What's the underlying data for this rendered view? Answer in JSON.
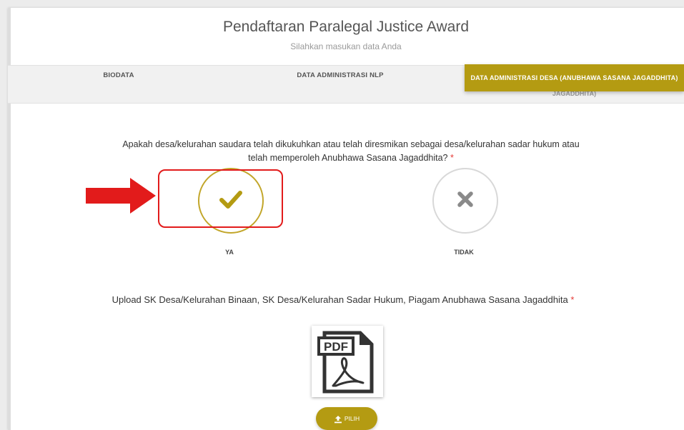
{
  "header": {
    "title": "Pendaftaran Paralegal Justice Award",
    "subtitle": "Silahkan masukan data Anda"
  },
  "tabs": [
    {
      "label": "BIODATA",
      "active": false
    },
    {
      "label": "DATA ADMINISTRASI NLP",
      "active": false
    },
    {
      "label": "DATA ADMINISTRASI DESA (ANUBHAWA SASANA JAGADDHITA)",
      "active": true,
      "overflow_text": "JAGADDHITA)"
    }
  ],
  "question": {
    "line1": "Apakah desa/kelurahan saudara telah dikukuhkan atau telah diresmikan sebagai desa/kelurahan sadar hukum atau",
    "line2": "telah memperoleh Anubhawa Sasana Jagaddhita?",
    "required_mark": "*"
  },
  "choices": {
    "yes": {
      "label": "YA",
      "icon": "check-icon",
      "selected": true
    },
    "no": {
      "label": "TIDAK",
      "icon": "times-icon",
      "selected": false
    }
  },
  "upload": {
    "title": "Upload SK Desa/Kelurahan Binaan, SK Desa/Kelurahan Sadar Hukum, Piagam Anubhawa Sasana Jagaddhita",
    "required_mark": "*",
    "file_type_badge": "PDF",
    "button_label": "PILIH",
    "button_icon": "upload-icon"
  },
  "colors": {
    "accent": "#b49b12",
    "required": "#e53935",
    "annotation": "#e21b1b"
  }
}
